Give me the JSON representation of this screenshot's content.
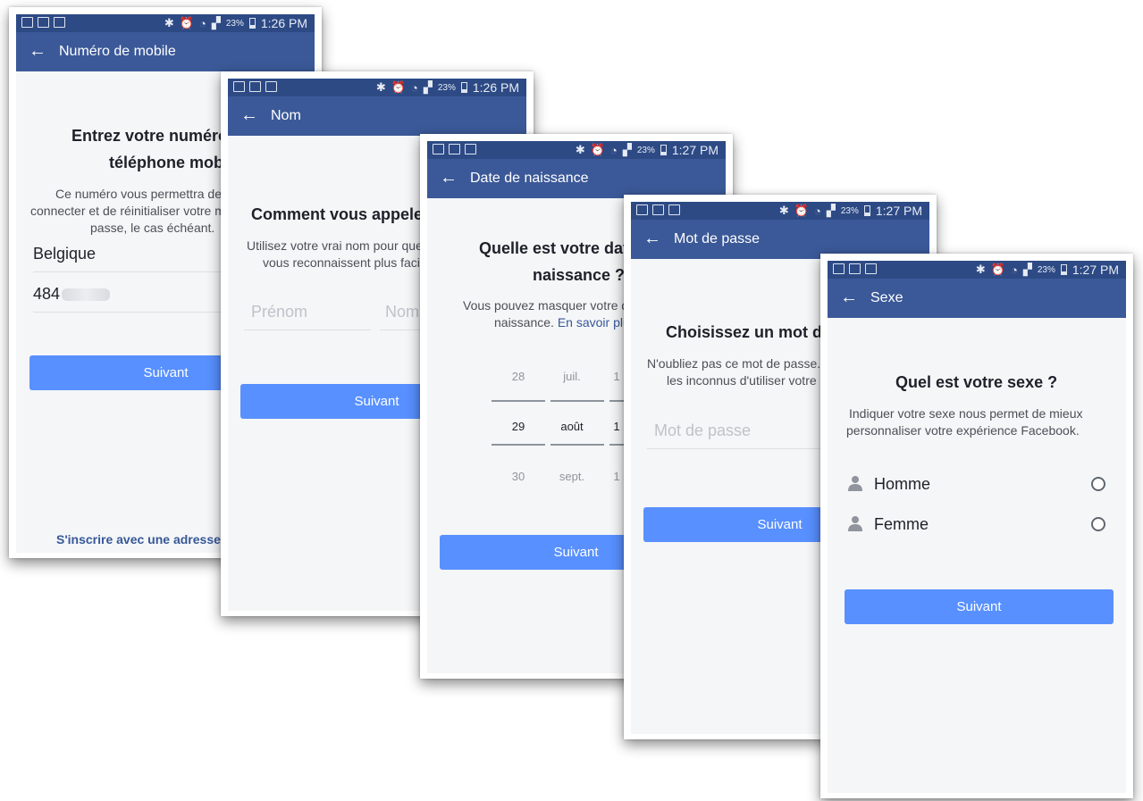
{
  "status": {
    "battery": "23%",
    "time1": "1:26 PM",
    "time2": "1:26 PM",
    "time3": "1:27 PM",
    "time4": "1:27 PM",
    "time5": "1:27 PM"
  },
  "screen1": {
    "title": "Numéro de mobile",
    "heading_line1": "Entrez votre numéro de",
    "heading_line2": "téléphone mobile",
    "desc_line1": "Ce numéro vous permettra de vous",
    "desc_line2": "connecter et de réinitialiser votre mot de",
    "desc_line3": "passe, le cas échéant.",
    "country": "Belgique",
    "phone_prefix": "484",
    "next_label": "Suivant",
    "email_link": "S'inscrire avec une adresse e-mail"
  },
  "screen2": {
    "title": "Nom",
    "heading": "Comment vous appelez-vous ?",
    "desc_line1": "Utilisez votre vrai nom pour que vos amis",
    "desc_line2": "vous reconnaissent plus facilement.",
    "first_name_placeholder": "Prénom",
    "last_name_placeholder": "Nom",
    "next_label": "Suivant"
  },
  "screen3": {
    "title": "Date de naissance",
    "heading_line1": "Quelle est votre date de",
    "heading_line2": "naissance ?",
    "desc_line1": "Vous pouvez masquer votre date de",
    "desc_line2": "naissance.",
    "learn_more": "En savoir plus",
    "days": [
      "28",
      "29",
      "30"
    ],
    "months": [
      "juil.",
      "août",
      "sept."
    ],
    "years": [
      "1",
      "1",
      "1"
    ],
    "next_label": "Suivant"
  },
  "screen4": {
    "title": "Mot de passe",
    "heading": "Choisissez un mot de passe",
    "desc_line1": "N'oubliez pas ce mot de passe. Il empêche",
    "desc_line2": "les inconnus d'utiliser votre compte.",
    "password_placeholder": "Mot de passe",
    "next_label": "Suivant"
  },
  "screen5": {
    "title": "Sexe",
    "heading": "Quel est votre sexe ?",
    "desc_line1": "Indiquer votre sexe nous permet de mieux",
    "desc_line2": "personnaliser votre expérience Facebook.",
    "option_male": "Homme",
    "option_female": "Femme",
    "next_label": "Suivant"
  },
  "colors": {
    "status_bar": "#2d4a85",
    "app_bar": "#3b5998",
    "button": "#5890ff",
    "background": "#f5f6f7"
  }
}
